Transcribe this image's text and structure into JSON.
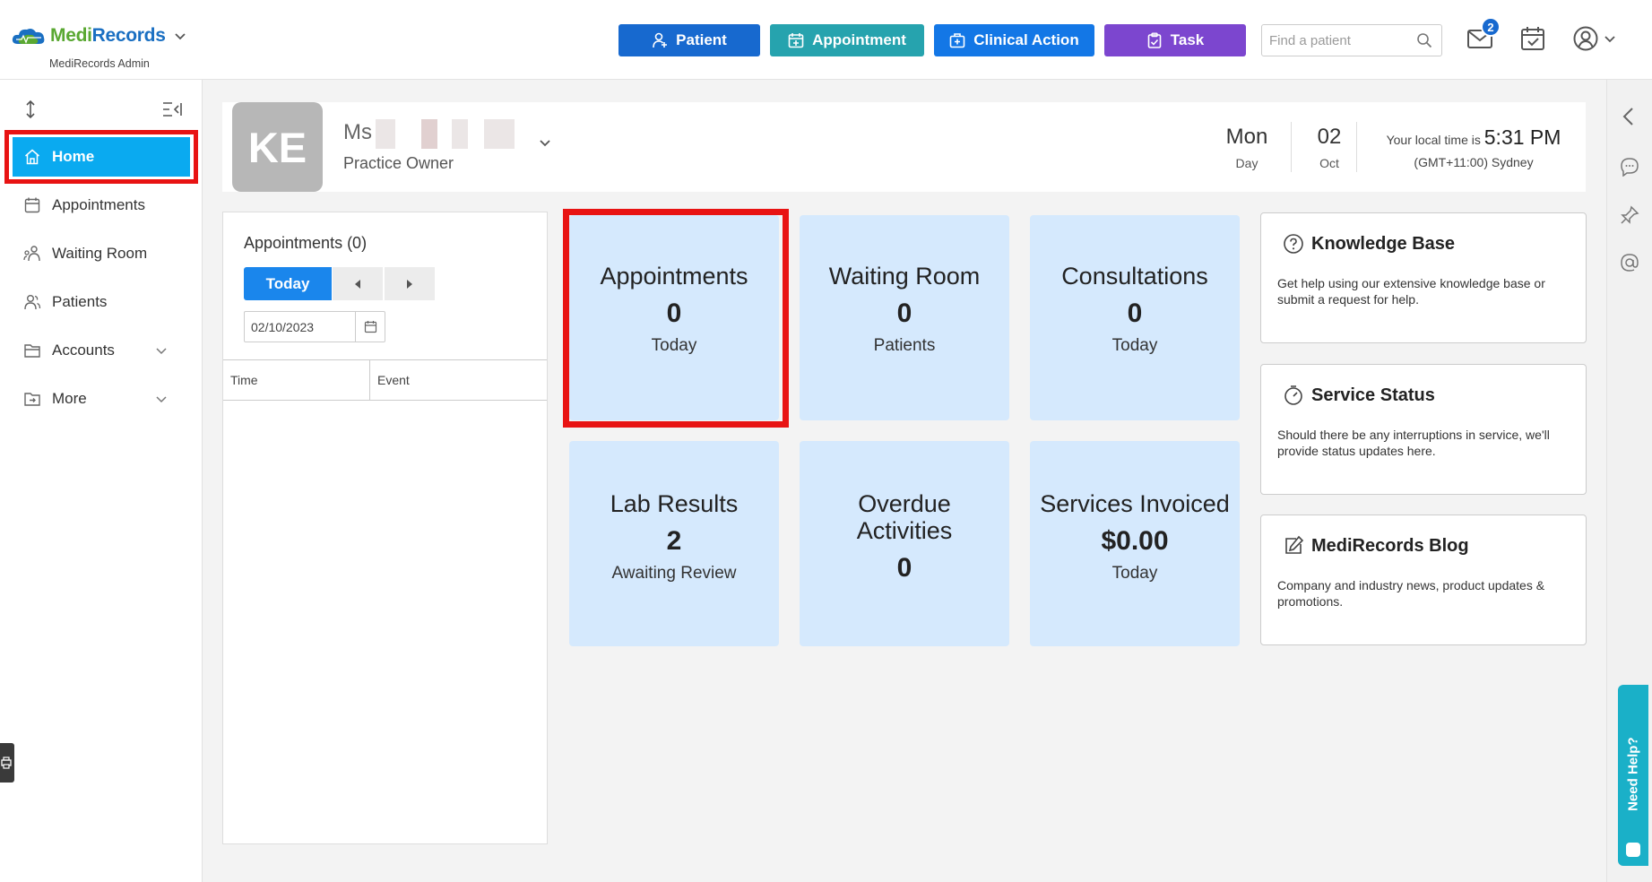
{
  "app": {
    "brand_part1": "Medi",
    "brand_part2": "Records",
    "subtitle": "MediRecords Admin"
  },
  "topbar": {
    "buttons": {
      "patient": "Patient",
      "appointment": "Appointment",
      "clinical_action": "Clinical Action",
      "task": "Task"
    },
    "search_placeholder": "Find a patient",
    "mail_count": "2"
  },
  "sidebar": {
    "items": [
      {
        "label": "Home"
      },
      {
        "label": "Appointments"
      },
      {
        "label": "Waiting Room"
      },
      {
        "label": "Patients"
      },
      {
        "label": "Accounts"
      },
      {
        "label": "More"
      }
    ]
  },
  "profile": {
    "initials": "KE",
    "name_prefix": "Ms",
    "role": "Practice Owner",
    "day": "Mon",
    "day_label": "Day",
    "date": "02",
    "month": "Oct",
    "local_time_prefix": "Your local time is",
    "local_time": "5:31 PM",
    "timezone": "(GMT+11:00) Sydney"
  },
  "appointments_panel": {
    "title": "Appointments (0)",
    "today_button": "Today",
    "date_value": "02/10/2023",
    "columns": [
      "Time",
      "Event"
    ]
  },
  "tiles": [
    {
      "title": "Appointments",
      "value": "0",
      "sub": "Today"
    },
    {
      "title": "Waiting Room",
      "value": "0",
      "sub": "Patients"
    },
    {
      "title": "Consultations",
      "value": "0",
      "sub": "Today"
    },
    {
      "title": "Lab Results",
      "value": "2",
      "sub": "Awaiting Review"
    },
    {
      "title": "Overdue Activities",
      "value": "0",
      "sub": ""
    },
    {
      "title": "Services Invoiced",
      "value": "$0.00",
      "sub": "Today"
    }
  ],
  "cards": [
    {
      "title": "Knowledge Base",
      "body": "Get help using our extensive knowledge base or submit a request for help."
    },
    {
      "title": "Service Status",
      "body": "Should there be any interruptions in service, we'll provide status updates here."
    },
    {
      "title": "MediRecords Blog",
      "body": "Company and industry news, product updates & promotions."
    }
  ],
  "need_help": "Need Help?",
  "colors": {
    "primary_blue": "#1769cf",
    "teal": "#26a3ae",
    "clinical_blue": "#1377e6",
    "task_purple": "#7c46cf",
    "sidebar_active": "#0aaaf0",
    "tile_bg": "#d5e9fd",
    "highlight_red": "#e81313"
  }
}
